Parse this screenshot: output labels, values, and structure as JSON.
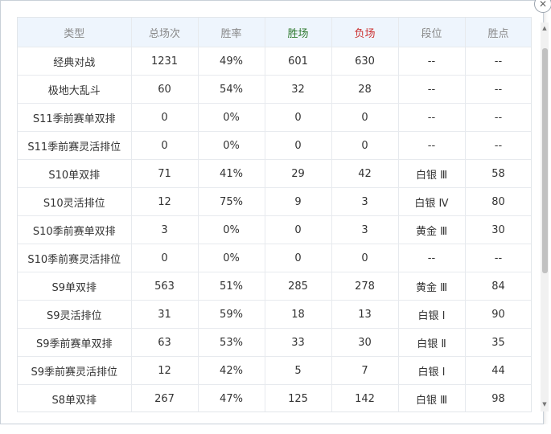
{
  "dialog": {
    "close_label": "✕"
  },
  "table": {
    "headers": {
      "type": "类型",
      "total": "总场次",
      "winrate": "胜率",
      "wins": "胜场",
      "losses": "负场",
      "rank": "段位",
      "points": "胜点"
    },
    "rows": [
      [
        "经典对战",
        "1231",
        "49%",
        "601",
        "630",
        "--",
        "--"
      ],
      [
        "极地大乱斗",
        "60",
        "54%",
        "32",
        "28",
        "--",
        "--"
      ],
      [
        "S11季前赛单双排",
        "0",
        "0%",
        "0",
        "0",
        "--",
        "--"
      ],
      [
        "S11季前赛灵活排位",
        "0",
        "0%",
        "0",
        "0",
        "--",
        "--"
      ],
      [
        "S10单双排",
        "71",
        "41%",
        "29",
        "42",
        "白银 Ⅲ",
        "58"
      ],
      [
        "S10灵活排位",
        "12",
        "75%",
        "9",
        "3",
        "白银 Ⅳ",
        "80"
      ],
      [
        "S10季前赛单双排",
        "3",
        "0%",
        "0",
        "3",
        "黄金 Ⅲ",
        "30"
      ],
      [
        "S10季前赛灵活排位",
        "0",
        "0%",
        "0",
        "0",
        "--",
        "--"
      ],
      [
        "S9单双排",
        "563",
        "51%",
        "285",
        "278",
        "黄金 Ⅲ",
        "84"
      ],
      [
        "S9灵活排位",
        "31",
        "59%",
        "18",
        "13",
        "白银 Ⅰ",
        "90"
      ],
      [
        "S9季前赛单双排",
        "63",
        "53%",
        "33",
        "30",
        "白银 Ⅱ",
        "35"
      ],
      [
        "S9季前赛灵活排位",
        "12",
        "42%",
        "5",
        "7",
        "白银 Ⅰ",
        "44"
      ],
      [
        "S8单双排",
        "267",
        "47%",
        "125",
        "142",
        "白银 Ⅲ",
        "98"
      ]
    ]
  },
  "colors": {
    "header_bg": "#eef5fd",
    "wins_header": "#2f7a2f",
    "losses_header": "#cc3333"
  },
  "icons": {
    "close": "close-icon",
    "scroll_up": "triangle-up-icon",
    "scroll_down": "triangle-down-icon"
  }
}
